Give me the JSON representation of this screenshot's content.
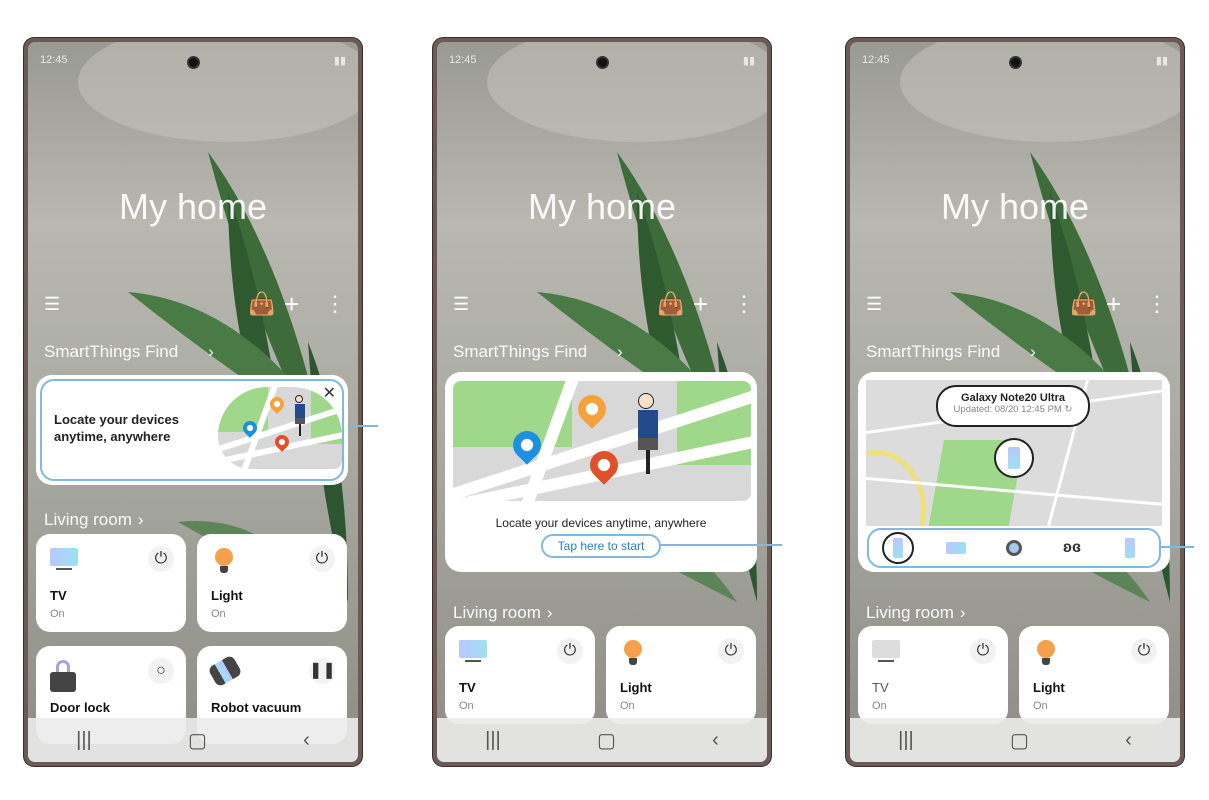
{
  "status_time": "12:45",
  "home_title": "My home",
  "find_label": "SmartThings Find",
  "living_room": "Living room",
  "promo_text_line1": "Locate your devices",
  "promo_text_line2": "anytime, anywhere",
  "promo_text": "Locate your devices anytime, anywhere",
  "start_button": "Tap here to start",
  "device_popup": {
    "name": "Galaxy Note20 Ultra",
    "updated": "Updated: 08/20 12:45 PM"
  },
  "tiles": [
    {
      "name": "TV",
      "status": "On",
      "icon": "tv-icon"
    },
    {
      "name": "Light",
      "status": "On",
      "icon": "bulb-icon"
    },
    {
      "name": "Door lock",
      "icon": "lock-icon"
    },
    {
      "name": "Robot vacuum",
      "icon": "vacuum-icon"
    }
  ],
  "device_strip": [
    "phone-icon",
    "tablet-icon",
    "watch-icon",
    "earbuds-icon",
    "phone-icon"
  ],
  "colors": {
    "accent": "#7fb8e0",
    "map_green": "#9fd88a",
    "pin_blue": "#1e90e0",
    "pin_orange": "#f5a23a",
    "pin_red": "#e0502a"
  }
}
